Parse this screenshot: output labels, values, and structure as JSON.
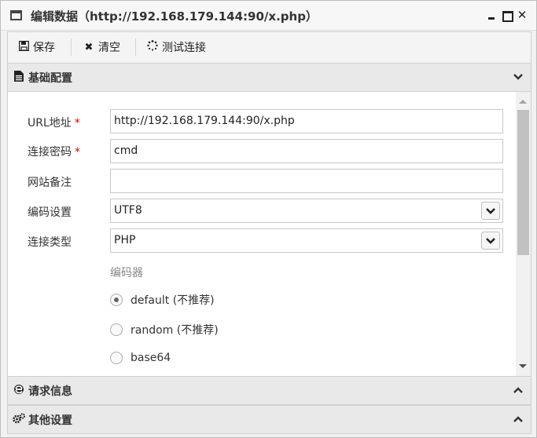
{
  "window": {
    "title": "编辑数据（http://192.168.179.144:90/x.php）"
  },
  "toolbar": {
    "save_label": "保存",
    "clear_label": "清空",
    "test_label": "测试连接"
  },
  "sections": {
    "basic": "基础配置",
    "request": "请求信息",
    "other": "其他设置"
  },
  "form": {
    "url_label": "URL地址",
    "url_value": "http://192.168.179.144:90/x.php",
    "password_label": "连接密码",
    "password_value": "cmd",
    "note_label": "网站备注",
    "note_value": "",
    "encoding_label": "编码设置",
    "encoding_value": "UTF8",
    "type_label": "连接类型",
    "type_value": "PHP",
    "required_mark": "*",
    "encoder_label": "编码器",
    "encoders": [
      {
        "label": "default (不推荐)",
        "checked": true
      },
      {
        "label": "random (不推荐)",
        "checked": false
      },
      {
        "label": "base64",
        "checked": false
      }
    ]
  },
  "icons": {
    "window": "window-icon",
    "save": "floppy-icon",
    "clear": "x-icon",
    "test": "spinner-icon",
    "basic": "document-icon",
    "request": "ie-icon",
    "other": "gears-icon"
  }
}
